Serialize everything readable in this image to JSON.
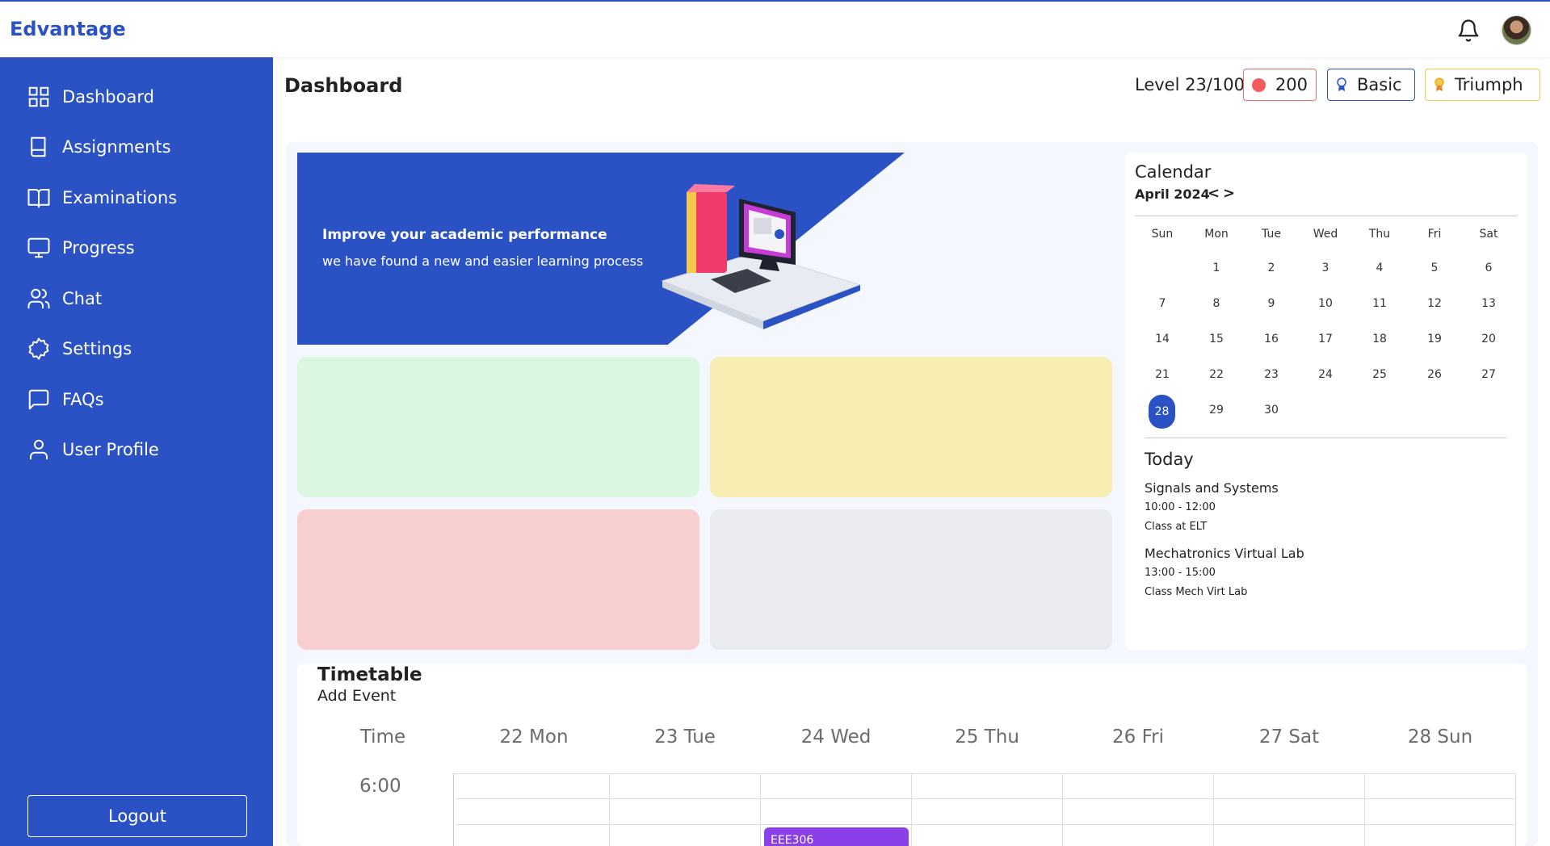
{
  "app": {
    "brand": "Edvantage"
  },
  "sidebar": {
    "items": [
      {
        "label": "Dashboard",
        "icon": "dashboard-grid-icon"
      },
      {
        "label": "Assignments",
        "icon": "book-icon"
      },
      {
        "label": "Examinations",
        "icon": "open-book-icon"
      },
      {
        "label": "Progress",
        "icon": "monitor-icon"
      },
      {
        "label": "Chat",
        "icon": "users-icon"
      },
      {
        "label": "Settings",
        "icon": "gear-icon"
      },
      {
        "label": "FAQs",
        "icon": "message-square-icon"
      },
      {
        "label": "User Profile",
        "icon": "user-icon"
      }
    ],
    "logout_label": "Logout"
  },
  "header": {
    "title": "Dashboard",
    "level": "Level 23/100",
    "coins": "200",
    "tier": "Basic",
    "rank": "Triumph"
  },
  "banner": {
    "title": "Improve your academic performance",
    "subtitle": "we have found a new and easier learning process"
  },
  "calendar": {
    "title": "Calendar",
    "month": "April 2024",
    "prev": "<",
    "next": ">",
    "weekdays": [
      "Sun",
      "Mon",
      "Tue",
      "Wed",
      "Thu",
      "Fri",
      "Sat"
    ],
    "days": [
      "1",
      "2",
      "3",
      "4",
      "5",
      "6",
      "7",
      "8",
      "9",
      "10",
      "11",
      "12",
      "13",
      "14",
      "15",
      "16",
      "17",
      "18",
      "19",
      "20",
      "21",
      "22",
      "23",
      "24",
      "25",
      "26",
      "27",
      "28",
      "29",
      "30"
    ],
    "selected_day": "28",
    "today_title": "Today",
    "events": [
      {
        "name": "Signals and Systems",
        "time": "10:00 - 12:00",
        "location": "Class at ELT"
      },
      {
        "name": "Mechatronics Virtual Lab",
        "time": "13:00 - 15:00",
        "location": "Class Mech Virt Lab"
      }
    ]
  },
  "timetable": {
    "title": "Timetable",
    "add_event": "Add Event",
    "columns": [
      "Time",
      "22 Mon",
      "23 Tue",
      "24 Wed",
      "25 Thu",
      "26 Fri",
      "27 Sat",
      "28 Sun"
    ],
    "time_label": "6:00",
    "event_label": "EEE306"
  },
  "colors": {
    "brand": "#2b52c4",
    "card_green": "#dcf7e1",
    "card_yellow": "#f8eeb4",
    "card_red": "#f8cfd1",
    "card_gray": "#e9ebef",
    "event": "#8a3fe8"
  }
}
